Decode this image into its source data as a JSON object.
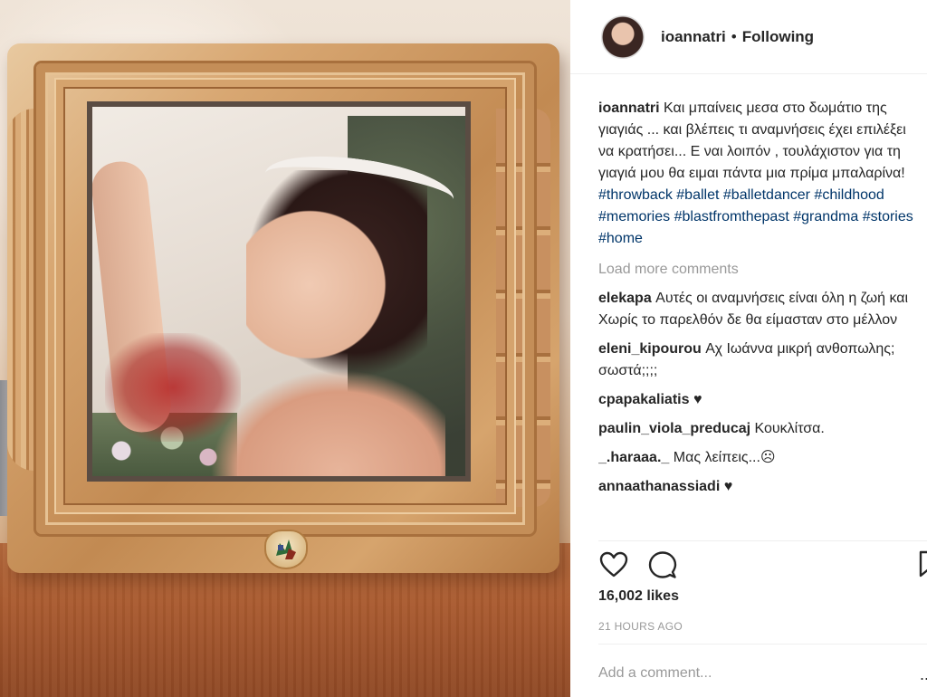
{
  "header": {
    "username": "ioannatri",
    "separator": "•",
    "follow_status": "Following"
  },
  "caption": {
    "username": "ioannatri",
    "text": "Και μπαίνεις μεσα στο δωμάτιο της γιαγιάς ... και βλέπεις τι αναμνήσεις έχει επιλέξει να κρατήσει... Ε ναι λοιπόν , τουλάχιστον για τη γιαγιά μου θα ειμαι πάντα μια πρίμα μπαλαρίνα!",
    "hashtags": [
      "#throwback",
      "#ballet",
      "#balletdancer",
      "#childhood",
      "#memories",
      "#blastfromthepast",
      "#grandma",
      "#stories",
      "#home"
    ]
  },
  "load_more": "Load more comments",
  "comments": [
    {
      "user": "elekapa",
      "text": "Αυτές οι αναμνήσεις είναι όλη η ζωή και Χωρίς το παρελθόν δε θα είμασταν στο μέλλον"
    },
    {
      "user": "eleni_kipourou",
      "text": "Αχ Ιωάννα μικρή ανθοπωλης; σωστά;;;;"
    },
    {
      "user": "cpapakaliatis",
      "text": "♥"
    },
    {
      "user": "paulin_viola_preducaj",
      "text": "Κουκλίτσα."
    },
    {
      "user": "_.haraaa._",
      "text": "Μας λείπεις...☹"
    },
    {
      "user": "annaathanassiadi",
      "text": "♥"
    }
  ],
  "actions": {
    "icons": [
      "heart-icon",
      "comment-icon",
      "bookmark-icon"
    ]
  },
  "likes": "16,002 likes",
  "timestamp": "21 HOURS AGO",
  "add_comment": {
    "placeholder": "Add a comment..."
  },
  "more_options": "..."
}
